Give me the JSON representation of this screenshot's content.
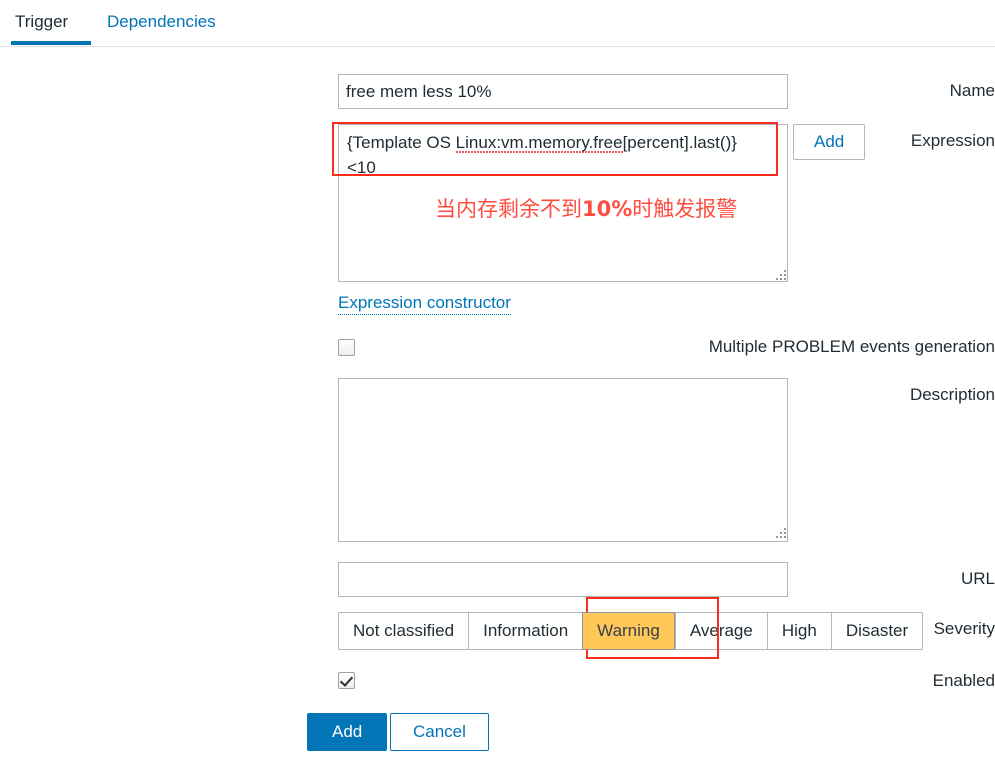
{
  "tabs": [
    {
      "label": "Trigger",
      "active": true
    },
    {
      "label": "Dependencies",
      "active": false
    }
  ],
  "form": {
    "name": {
      "label": "Name",
      "value": "free mem less 10%",
      "placeholder": ""
    },
    "expression": {
      "label": "Expression",
      "value_line1": "{Template OS Linux:vm.memory.free[percent].last()}",
      "value_line2": "<10",
      "spellchecked_fragment": "Linux:vm.memory.free",
      "value_prefix": "{Template OS ",
      "value_suffix": "[percent].last()}",
      "add_button": "Add",
      "constructor_link": "Expression constructor",
      "annotation": "当内存剩余不到10%时触发报警",
      "annotation_color": "#fe4e42"
    },
    "multiple_problem": {
      "label": "Multiple PROBLEM events generation",
      "checked": false
    },
    "description": {
      "label": "Description",
      "value": "",
      "placeholder": ""
    },
    "url": {
      "label": "URL",
      "value": "",
      "placeholder": ""
    },
    "severity": {
      "label": "Severity",
      "options": [
        "Not classified",
        "Information",
        "Warning",
        "Average",
        "High",
        "Disaster"
      ],
      "selected": "Warning",
      "selected_color": "#ffc859"
    },
    "enabled": {
      "label": "Enabled",
      "checked": true
    }
  },
  "footer": {
    "submit_label": "Add",
    "cancel_label": "Cancel"
  },
  "colors": {
    "accent": "#0275b8",
    "annotation_red": "#fb2c1c",
    "warning_amber": "#ffc859",
    "border": "#aeb7bd",
    "text": "#1f2c33"
  }
}
